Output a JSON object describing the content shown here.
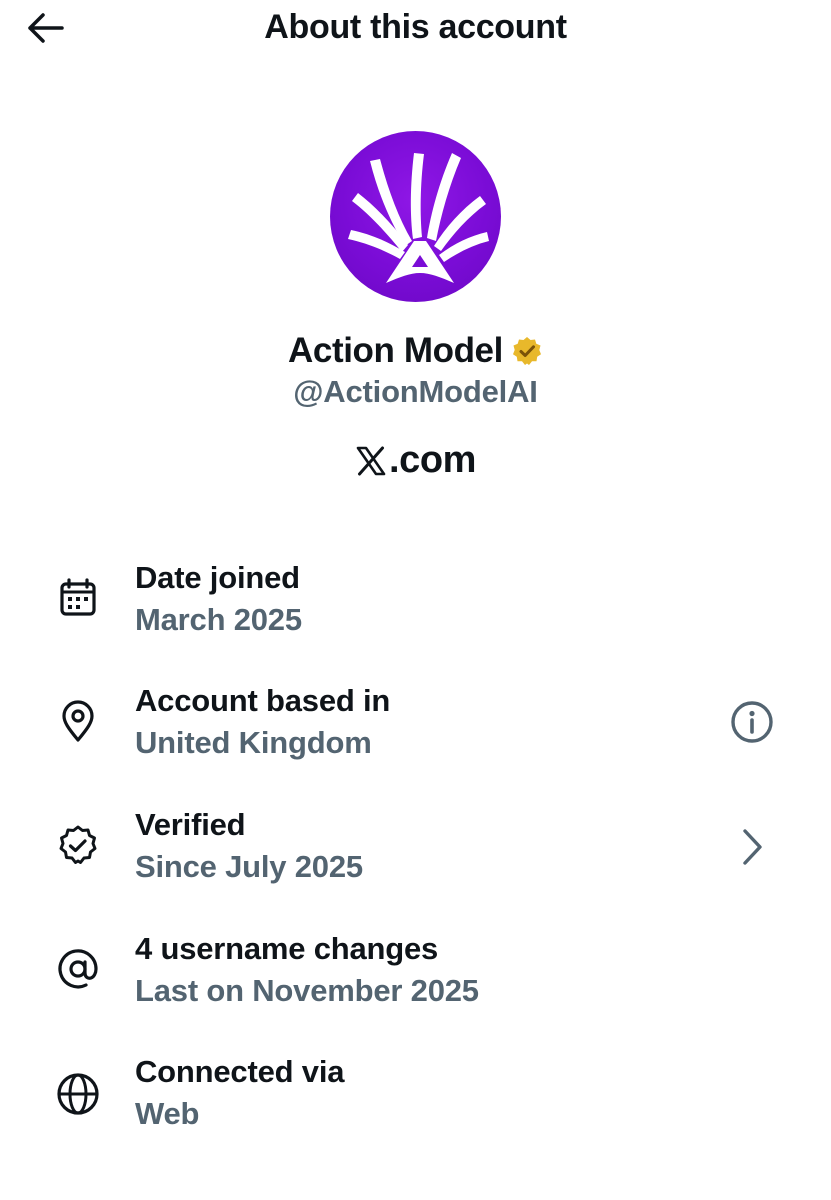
{
  "header": {
    "title": "About this account",
    "back_icon": "arrow-left-icon"
  },
  "profile": {
    "display_name": "Action Model",
    "handle": "@ActionModelAI",
    "site_label": ".com",
    "verified_badge_color": "#e8b82b",
    "avatar_color": "#7a0cd6"
  },
  "details": [
    {
      "icon": "calendar-icon",
      "title": "Date joined",
      "value": "March 2025"
    },
    {
      "icon": "location-pin-icon",
      "title": "Account based in",
      "value": "United Kingdom",
      "action_icon": "info-icon"
    },
    {
      "icon": "verified-badge-icon",
      "title": "Verified",
      "value": "Since July 2025",
      "action_icon": "chevron-right-icon"
    },
    {
      "icon": "at-sign-icon",
      "title": "4 username changes",
      "value": "Last on November 2025"
    },
    {
      "icon": "globe-icon",
      "title": "Connected via",
      "value": "Web"
    }
  ],
  "colors": {
    "primary_text": "#0f1419",
    "secondary_text": "#536471",
    "background": "#ffffff"
  }
}
